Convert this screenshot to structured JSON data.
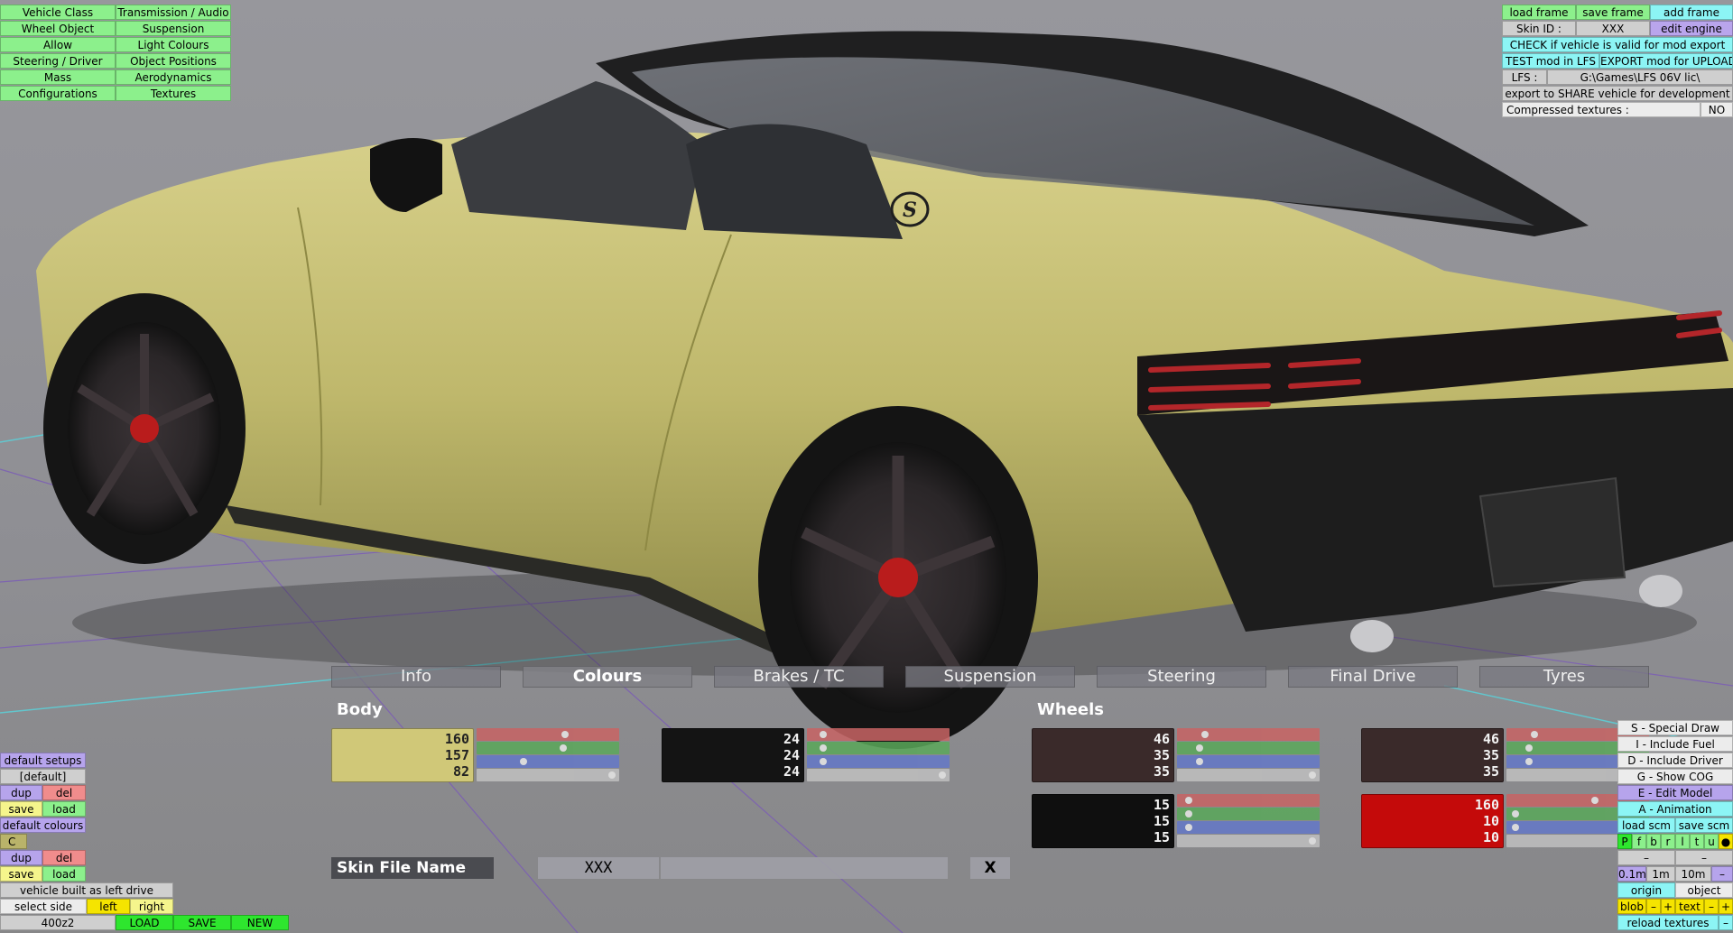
{
  "menu_left": [
    [
      "Vehicle Class",
      "Transmission / Audio"
    ],
    [
      "Wheel Object",
      "Suspension"
    ],
    [
      "Allow",
      "Light Colours"
    ],
    [
      "Steering / Driver",
      "Object Positions"
    ],
    [
      "Mass",
      "Aerodynamics"
    ],
    [
      "Configurations",
      "Textures"
    ]
  ],
  "top_right": {
    "load_frame": "load frame",
    "save_frame": "save frame",
    "add_frame": "add frame",
    "skin_id_label": "Skin ID :",
    "skin_id_value": "XXX",
    "edit_engine": "edit engine",
    "check_valid": "CHECK if vehicle is valid for mod export",
    "test_mod": "TEST mod in LFS",
    "export_mod": "EXPORT mod for UPLOAD",
    "lfs_label": "LFS :",
    "lfs_path": "G:\\Games\\LFS 06V lic\\",
    "export_share": "export to SHARE vehicle for development",
    "compressed_label": "Compressed textures :",
    "compressed_value": "NO"
  },
  "tabs": [
    "Info",
    "Colours",
    "Brakes / TC",
    "Suspension",
    "Steering",
    "Final Drive",
    "Tyres"
  ],
  "active_tab": "Colours",
  "colours": {
    "body_label": "Body",
    "wheels_label": "Wheels",
    "body_main": {
      "r": 160,
      "g": 157,
      "b": 82,
      "color": "#d0c878"
    },
    "body_second": {
      "r": 24,
      "g": 24,
      "b": 24,
      "color": "#141414"
    },
    "wheel_a": {
      "r": 46,
      "g": 35,
      "b": 35,
      "color": "#3a2a2a"
    },
    "wheel_b": {
      "r": 15,
      "g": 15,
      "b": 15,
      "color": "#0f0f0f"
    },
    "wheel_c": {
      "r": 46,
      "g": 35,
      "b": 35,
      "color": "#3a2a2a"
    },
    "wheel_d": {
      "r": 160,
      "g": 10,
      "b": 10,
      "color": "#c40a0a"
    }
  },
  "skin": {
    "label": "Skin File Name",
    "value": "XXX",
    "clear": "X"
  },
  "bottom_left": {
    "default_setups": "default setups",
    "default_value": "[default]",
    "dup": "dup",
    "del": "del",
    "save": "save",
    "load": "load",
    "default_colours": "default colours",
    "c_value": "C",
    "built_as": "vehicle built as left drive",
    "select_side": "select side",
    "left": "left",
    "right": "right",
    "vehicle_code": "400z2",
    "load_upper": "LOAD",
    "save_upper": "SAVE",
    "new_upper": "NEW"
  },
  "bottom_right": {
    "special_draw": "S - Special Draw",
    "include_fuel": "I - Include Fuel",
    "include_driver": "D - Include Driver",
    "show_cog": "G - Show COG",
    "edit_model": "E - Edit Model",
    "animation": "A - Animation",
    "load_scm": "load scm",
    "save_scm": "save scm",
    "letters": [
      "P",
      "f",
      "b",
      "r",
      "l",
      "t",
      "u",
      "●"
    ],
    "minus": "–",
    "step_01": "0.1m",
    "step_1": "1m",
    "step_10": "10m",
    "origin": "origin",
    "object": "object",
    "blob": "blob",
    "plus": "+",
    "text": "text",
    "reload_textures": "reload textures"
  },
  "car": {
    "emblem": "S"
  }
}
